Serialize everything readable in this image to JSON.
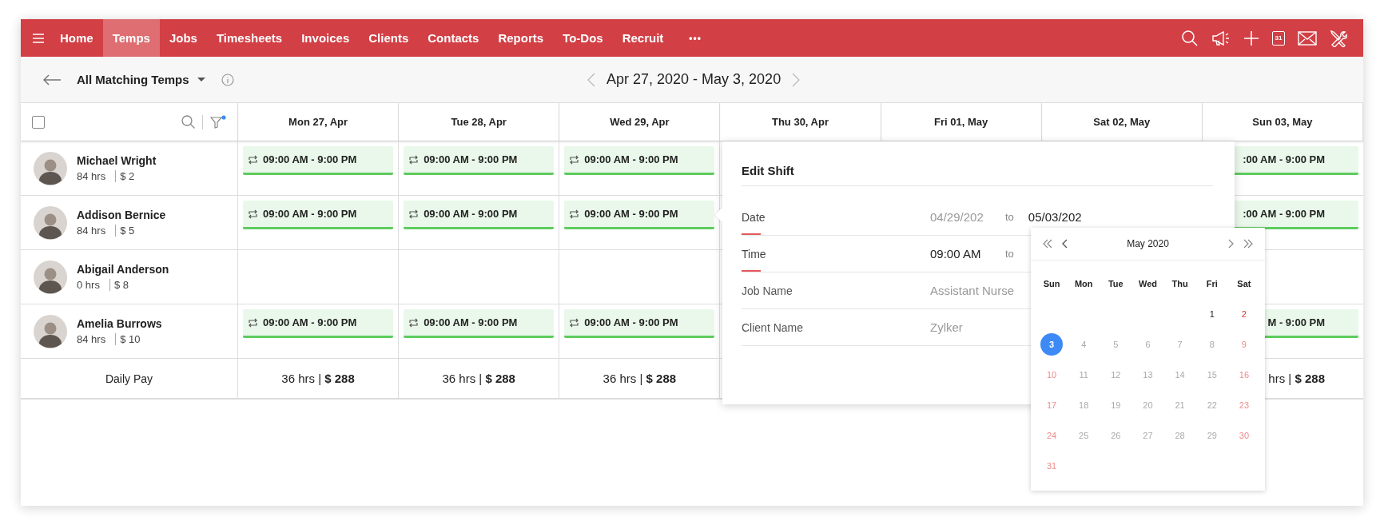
{
  "nav": {
    "items": [
      {
        "label": "Home",
        "selected": false
      },
      {
        "label": "Temps",
        "selected": true
      },
      {
        "label": "Jobs",
        "selected": false
      },
      {
        "label": "Timesheets",
        "selected": false
      },
      {
        "label": "Invoices",
        "selected": false
      },
      {
        "label": "Clients",
        "selected": false
      },
      {
        "label": "Contacts",
        "selected": false
      },
      {
        "label": "Reports",
        "selected": false
      },
      {
        "label": "To-Dos",
        "selected": false
      },
      {
        "label": "Recruit",
        "selected": false
      }
    ],
    "more": "•••",
    "calendar_day": "31"
  },
  "toolbar": {
    "view": "All Matching Temps",
    "range": "Apr 27, 2020 - May 3, 2020"
  },
  "table": {
    "select_all": {
      "checked": false
    },
    "filter_active": true,
    "days": [
      "Mon 27, Apr",
      "Tue 28, Apr",
      "Wed 29, Apr",
      "Thu 30, Apr",
      "Fri 01, May",
      "Sat 02, May",
      "Sun 03, May"
    ],
    "rows": [
      {
        "name": "Michael Wright",
        "hours": "84 hrs",
        "rate": "$ 2",
        "cells": [
          {
            "kind": "shift",
            "time": "09:00 AM - 9:00 PM"
          },
          {
            "kind": "shift",
            "time": "09:00 AM - 9:00 PM"
          },
          {
            "kind": "shift",
            "time": "09:00 AM - 9:00 PM"
          },
          {
            "kind": "covered"
          },
          {
            "kind": "covered"
          },
          {
            "kind": "covered"
          },
          {
            "kind": "partial",
            "time": ":00 AM - 9:00 PM"
          }
        ]
      },
      {
        "name": "Addison Bernice",
        "hours": "84 hrs",
        "rate": "$ 5",
        "cells": [
          {
            "kind": "shift",
            "time": "09:00 AM - 9:00 PM"
          },
          {
            "kind": "shift",
            "time": "09:00 AM - 9:00 PM"
          },
          {
            "kind": "shift",
            "time": "09:00 AM - 9:00 PM"
          },
          {
            "kind": "covered"
          },
          {
            "kind": "covered"
          },
          {
            "kind": "covered"
          },
          {
            "kind": "partial",
            "time": ":00 AM - 9:00 PM"
          }
        ]
      },
      {
        "name": "Abigail Anderson",
        "hours": "0 hrs",
        "rate": "$ 8",
        "cells": [
          {
            "kind": "empty"
          },
          {
            "kind": "empty"
          },
          {
            "kind": "empty"
          },
          {
            "kind": "covered"
          },
          {
            "kind": "covered"
          },
          {
            "kind": "covered"
          },
          {
            "kind": "empty"
          }
        ]
      },
      {
        "name": "Amelia Burrows",
        "hours": "84 hrs",
        "rate": "$ 10",
        "cells": [
          {
            "kind": "shift",
            "time": "09:00 AM - 9:00 PM"
          },
          {
            "kind": "shift",
            "time": "09:00 AM - 9:00 PM"
          },
          {
            "kind": "shift",
            "time": "09:00 AM - 9:00 PM"
          },
          {
            "kind": "covered"
          },
          {
            "kind": "covered"
          },
          {
            "kind": "covered"
          },
          {
            "kind": "partial",
            "time": "M - 9:00 PM"
          }
        ]
      }
    ],
    "daily_pay": {
      "label": "Daily Pay",
      "cells": [
        {
          "kind": "total",
          "text": "36 hrs | **$ 288**"
        },
        {
          "kind": "total",
          "text": "36 hrs | **$ 288**"
        },
        {
          "kind": "total",
          "text": "36 hrs | **$ 288**"
        },
        {
          "kind": "covered"
        },
        {
          "kind": "covered"
        },
        {
          "kind": "covered"
        },
        {
          "kind": "partial",
          "text": "hrs | **$ 288**"
        }
      ]
    }
  },
  "edit_shift": {
    "title": "Edit Shift",
    "fields": [
      {
        "label": "Date",
        "required": true,
        "value": "04/29/202",
        "disabled": true,
        "to": "to",
        "value_to": "05/03/202"
      },
      {
        "label": "Time",
        "required": true,
        "value": "09:00 AM",
        "disabled": false,
        "to": "to"
      },
      {
        "label": "Job Name",
        "required": false,
        "placeholder": "Assistant Nurse"
      },
      {
        "label": "Client Name",
        "required": false,
        "placeholder": "Zylker"
      }
    ]
  },
  "date_picker": {
    "month": "May 2020",
    "weekdays": [
      "Sun",
      "Mon",
      "Tue",
      "Wed",
      "Thu",
      "Fri",
      "Sat"
    ],
    "weeks": [
      [
        {
          "kind": "blank"
        },
        {
          "kind": "blank"
        },
        {
          "kind": "blank"
        },
        {
          "kind": "blank"
        },
        {
          "kind": "blank"
        },
        {
          "kind": "day",
          "day": "1",
          "disabled": false,
          "selected": false
        },
        {
          "kind": "day",
          "day": "2",
          "disabled": false,
          "selected": false
        }
      ],
      [
        {
          "kind": "day",
          "day": "3",
          "disabled": false,
          "selected": true
        },
        {
          "kind": "day",
          "day": "4",
          "disabled": true,
          "selected": false
        },
        {
          "kind": "day",
          "day": "5",
          "disabled": true,
          "selected": false
        },
        {
          "kind": "day",
          "day": "6",
          "disabled": true,
          "selected": false
        },
        {
          "kind": "day",
          "day": "7",
          "disabled": true,
          "selected": false
        },
        {
          "kind": "day",
          "day": "8",
          "disabled": true,
          "selected": false
        },
        {
          "kind": "day",
          "day": "9",
          "disabled": true,
          "selected": false
        }
      ],
      [
        {
          "kind": "day",
          "day": "10",
          "disabled": true,
          "selected": false
        },
        {
          "kind": "day",
          "day": "11",
          "disabled": true,
          "selected": false
        },
        {
          "kind": "day",
          "day": "12",
          "disabled": true,
          "selected": false
        },
        {
          "kind": "day",
          "day": "13",
          "disabled": true,
          "selected": false
        },
        {
          "kind": "day",
          "day": "14",
          "disabled": true,
          "selected": false
        },
        {
          "kind": "day",
          "day": "15",
          "disabled": true,
          "selected": false
        },
        {
          "kind": "day",
          "day": "16",
          "disabled": true,
          "selected": false
        }
      ],
      [
        {
          "kind": "day",
          "day": "17",
          "disabled": true,
          "selected": false
        },
        {
          "kind": "day",
          "day": "18",
          "disabled": true,
          "selected": false
        },
        {
          "kind": "day",
          "day": "19",
          "disabled": true,
          "selected": false
        },
        {
          "kind": "day",
          "day": "20",
          "disabled": true,
          "selected": false
        },
        {
          "kind": "day",
          "day": "21",
          "disabled": true,
          "selected": false
        },
        {
          "kind": "day",
          "day": "22",
          "disabled": true,
          "selected": false
        },
        {
          "kind": "day",
          "day": "23",
          "disabled": true,
          "selected": false
        }
      ],
      [
        {
          "kind": "day",
          "day": "24",
          "disabled": true,
          "selected": false
        },
        {
          "kind": "day",
          "day": "25",
          "disabled": true,
          "selected": false
        },
        {
          "kind": "day",
          "day": "26",
          "disabled": true,
          "selected": false
        },
        {
          "kind": "day",
          "day": "27",
          "disabled": true,
          "selected": false
        },
        {
          "kind": "day",
          "day": "28",
          "disabled": true,
          "selected": false
        },
        {
          "kind": "day",
          "day": "29",
          "disabled": true,
          "selected": false
        },
        {
          "kind": "day",
          "day": "30",
          "disabled": true,
          "selected": false
        }
      ],
      [
        {
          "kind": "day",
          "day": "31",
          "disabled": true,
          "selected": false
        },
        {
          "kind": "blank"
        },
        {
          "kind": "blank"
        },
        {
          "kind": "blank"
        },
        {
          "kind": "blank"
        },
        {
          "kind": "blank"
        },
        {
          "kind": "blank"
        }
      ]
    ]
  }
}
